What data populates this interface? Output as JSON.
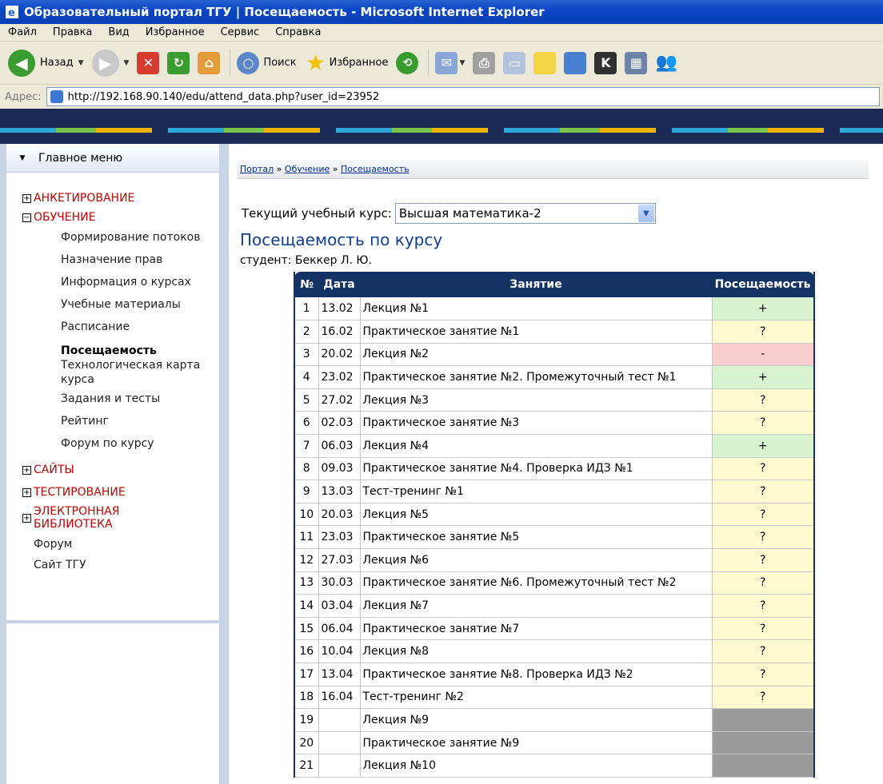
{
  "window": {
    "title": "Образовательный портал ТГУ | Посещаемость - Microsoft Internet Explorer"
  },
  "menu": [
    "Файл",
    "Правка",
    "Вид",
    "Избранное",
    "Сервис",
    "Справка"
  ],
  "toolbar": {
    "back_label": "Назад",
    "search_label": "Поиск",
    "favorites_label": "Избранное"
  },
  "address": {
    "label": "Адрес:",
    "url": "http://192.168.90.140/edu/attend_data.php?user_id=23952"
  },
  "sidebar": {
    "header": "Главное меню",
    "sections": {
      "survey": "АНКЕТИРОВАНИЕ",
      "learning": "ОБУЧЕНИЕ",
      "sites": "САЙТЫ",
      "testing": "ТЕСТИРОВАНИЕ",
      "library": "ЭЛЕКТРОННАЯ БИБЛИОТЕКА"
    },
    "learning_items": [
      "Формирование потоков",
      "Назначение прав",
      "Информация о курсах",
      "Учебные материалы",
      "Расписание",
      "Посещаемость",
      "Технологическая карта курса",
      "Задания и тесты",
      "Рейтинг",
      "Форум по курсу"
    ],
    "extra": [
      "Форум",
      "Сайт ТГУ"
    ]
  },
  "breadcrumb": [
    "Портал",
    "Обучение",
    "Посещаемость"
  ],
  "course": {
    "label": "Текущий учебный курс:",
    "selected": "Высшая математика-2"
  },
  "page": {
    "title": "Посещаемость по курсу",
    "student": "студент: Беккер Л. Ю."
  },
  "table": {
    "headers": [
      "№",
      "Дата",
      "Занятие",
      "Посещаемость"
    ],
    "rows": [
      {
        "n": "1",
        "date": "13.02",
        "topic": "Лекция №1",
        "status": "+",
        "kind": "yes"
      },
      {
        "n": "2",
        "date": "16.02",
        "topic": "Практическое занятие №1",
        "status": "?",
        "kind": "unk"
      },
      {
        "n": "3",
        "date": "20.02",
        "topic": "Лекция №2",
        "status": "-",
        "kind": "no"
      },
      {
        "n": "4",
        "date": "23.02",
        "topic": "Практическое занятие №2. Промежуточный тест №1",
        "status": "+",
        "kind": "yes"
      },
      {
        "n": "5",
        "date": "27.02",
        "topic": "Лекция №3",
        "status": "?",
        "kind": "unk"
      },
      {
        "n": "6",
        "date": "02.03",
        "topic": "Практическое занятие №3",
        "status": "?",
        "kind": "unk"
      },
      {
        "n": "7",
        "date": "06.03",
        "topic": "Лекция №4",
        "status": "+",
        "kind": "yes"
      },
      {
        "n": "8",
        "date": "09.03",
        "topic": "Практическое занятие №4. Проверка ИДЗ №1",
        "status": "?",
        "kind": "unk"
      },
      {
        "n": "9",
        "date": "13.03",
        "topic": "Тест-тренинг №1",
        "status": "?",
        "kind": "unk"
      },
      {
        "n": "10",
        "date": "20.03",
        "topic": "Лекция №5",
        "status": "?",
        "kind": "unk"
      },
      {
        "n": "11",
        "date": "23.03",
        "topic": "Практическое занятие №5",
        "status": "?",
        "kind": "unk"
      },
      {
        "n": "12",
        "date": "27.03",
        "topic": "Лекция №6",
        "status": "?",
        "kind": "unk"
      },
      {
        "n": "13",
        "date": "30.03",
        "topic": "Практическое занятие №6. Промежуточный тест №2",
        "status": "?",
        "kind": "unk"
      },
      {
        "n": "14",
        "date": "03.04",
        "topic": "Лекция №7",
        "status": "?",
        "kind": "unk"
      },
      {
        "n": "15",
        "date": "06.04",
        "topic": "Практическое занятие №7",
        "status": "?",
        "kind": "unk"
      },
      {
        "n": "16",
        "date": "10.04",
        "topic": "Лекция №8",
        "status": "?",
        "kind": "unk"
      },
      {
        "n": "17",
        "date": "13.04",
        "topic": "Практическое занятие №8. Проверка ИДЗ №2",
        "status": "?",
        "kind": "unk"
      },
      {
        "n": "18",
        "date": "16.04",
        "topic": "Тест-тренинг №2",
        "status": "?",
        "kind": "unk"
      },
      {
        "n": "19",
        "date": "",
        "topic": "Лекция №9",
        "status": "",
        "kind": "none"
      },
      {
        "n": "20",
        "date": "",
        "topic": "Практическое занятие №9",
        "status": "",
        "kind": "none"
      },
      {
        "n": "21",
        "date": "",
        "topic": "Лекция №10",
        "status": "",
        "kind": "none"
      }
    ]
  }
}
